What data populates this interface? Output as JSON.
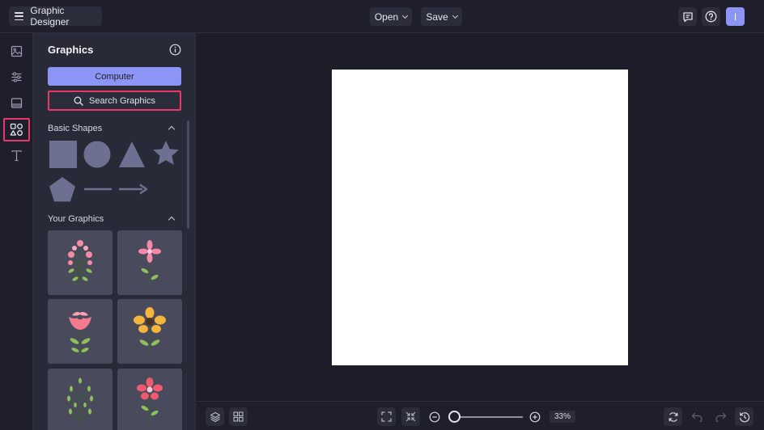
{
  "header": {
    "app_name": "Graphic Designer",
    "open_label": "Open",
    "save_label": "Save",
    "user_initial": "I",
    "icons": [
      "menu-icon",
      "comment-icon",
      "help-icon"
    ]
  },
  "rail": {
    "items": [
      {
        "name": "images",
        "icon": "image-icon"
      },
      {
        "name": "adjustments",
        "icon": "sliders-icon"
      },
      {
        "name": "layout",
        "icon": "layout-icon"
      },
      {
        "name": "graphics",
        "icon": "shapes-icon",
        "active": true
      },
      {
        "name": "text",
        "icon": "text-icon"
      }
    ]
  },
  "panel": {
    "title": "Graphics",
    "computer_label": "Computer",
    "search_label": "Search Graphics",
    "basic_shapes_label": "Basic Shapes",
    "your_graphics_label": "Your Graphics",
    "shapes": [
      "square",
      "circle",
      "triangle",
      "star",
      "pentagon",
      "line",
      "arrow"
    ],
    "graphics": [
      "pink-flower-bouquet",
      "pink-flower-stem",
      "red-tulip",
      "yellow-flower",
      "green-branch",
      "red-flower"
    ]
  },
  "bottom": {
    "zoom_label": "33%",
    "zoom_percent": 33
  },
  "colors": {
    "accent": "#8c94f6",
    "highlight": "#e8386d",
    "background": "#1c1d28",
    "panel": "#282a37"
  }
}
